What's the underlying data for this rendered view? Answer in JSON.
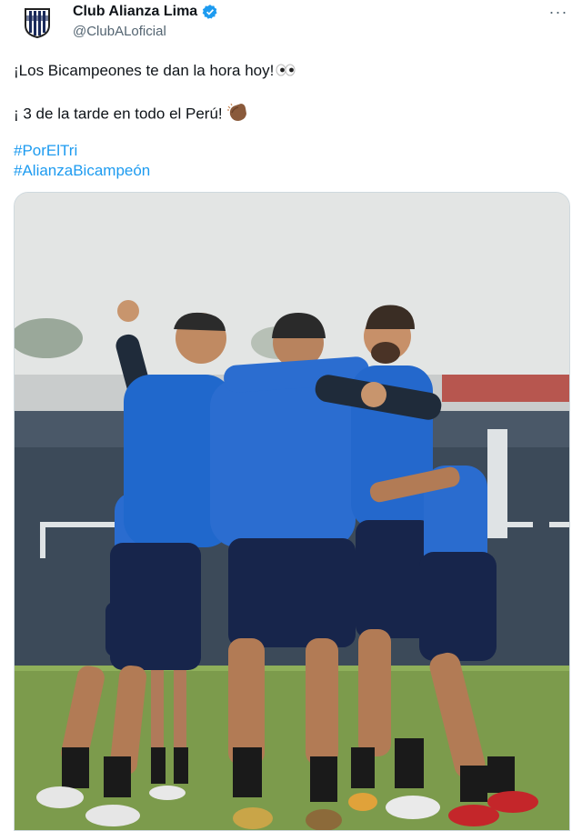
{
  "author": {
    "display_name": "Club Alianza Lima",
    "handle": "@ClubALoficial",
    "verified": true,
    "avatar_icon": "alianza-crest-icon"
  },
  "menu": {
    "icon": "more-options-icon",
    "glyph": "···"
  },
  "tweet": {
    "line1": "¡Los Bicampeones te dan la hora hoy!",
    "line2": "¡ 3 de la tarde en todo el Perú!",
    "hashtags": [
      "#PorElTri",
      "#AlianzaBicampeón"
    ]
  },
  "media": {
    "description_icon": "team-training-photo",
    "colors": {
      "kit": "#1d63c9",
      "shorts": "#16254a",
      "grass": "#7a9a4a",
      "sky": "#e4e6e5"
    }
  },
  "colors": {
    "link": "#1d9bf0",
    "verified": "#1d9bf0",
    "muted": "#536471"
  }
}
